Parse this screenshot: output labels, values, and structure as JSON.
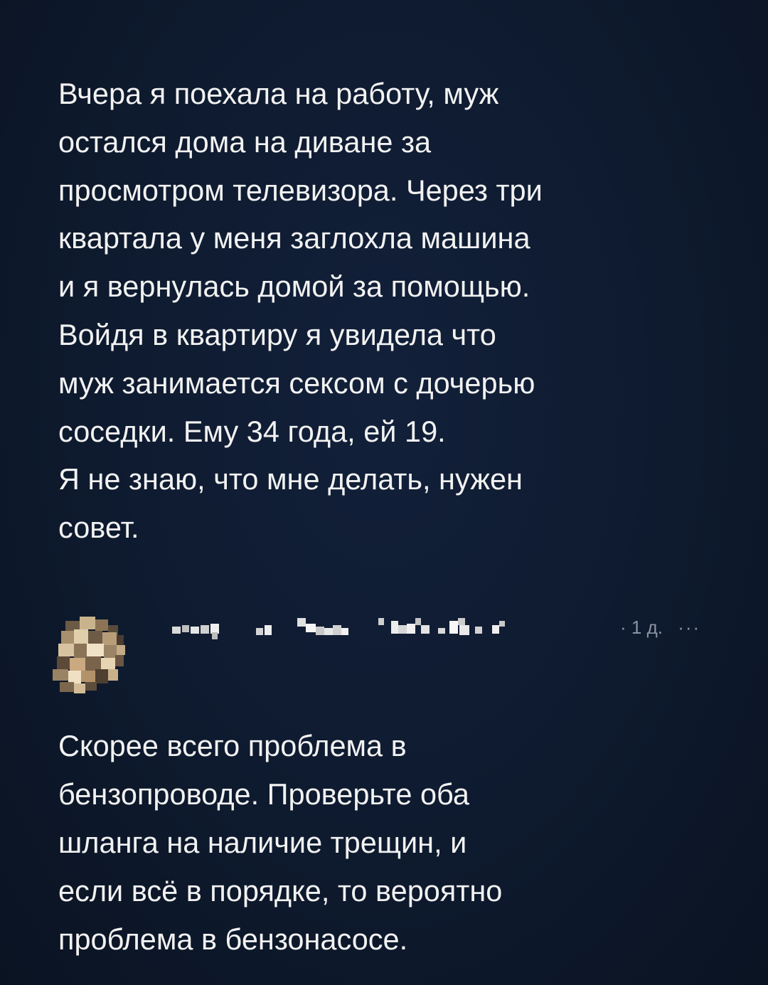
{
  "post": {
    "lines": [
      "Вчера я поехала на работу, муж",
      "остался дома на диване за",
      "просмотром телевизора. Через три",
      "квартала у меня заглохла машина",
      "и я вернулась домой за помощью.",
      "Войдя в квартиру я увидела что",
      "муж занимается сексом с дочерью",
      "соседки. Ему 34 года, ей 19.",
      "Я не знаю, что мне делать, нужен",
      "совет."
    ]
  },
  "comment": {
    "time": "· 1 д.",
    "more_icon": "ellipsis-icon",
    "more_glyph": "···",
    "lines": [
      "Скорее всего проблема в",
      "бензопроводе. Проверьте оба",
      "шланга на наличие трещин, и",
      "если всё в порядке, то вероятно",
      "проблема в бензонасосе."
    ]
  },
  "colors": {
    "background": "#0e1a2e",
    "text": "#f2f2f2",
    "meta": "#8b93a3"
  }
}
